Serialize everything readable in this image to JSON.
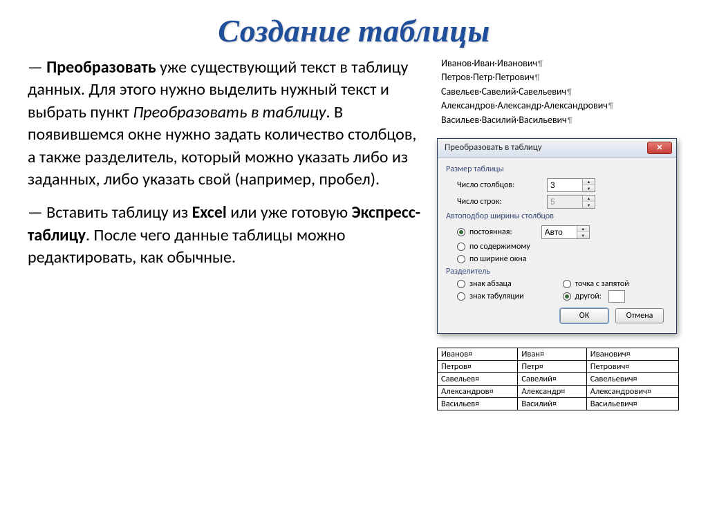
{
  "title": "Создание таблицы",
  "body": {
    "para1_pre": "— ",
    "para1_b1": "Преобразовать",
    "para1_mid1": " уже существующий текст в таблицу данных. Для этого нужно выделить нужный текст и выбрать пункт ",
    "para1_i1": "Преобразовать в таблицу",
    "para1_mid2": ". В появившемся окне нужно задать количество столбцов, а также разделитель, который  можно указать либо из заданных, либо указать свой (например, пробел).",
    "para2_pre": "— Вставить таблицу из ",
    "para2_b1": "Excel",
    "para2_mid1": " или уже готовую ",
    "para2_b2": "Экспресс-таблицу",
    "para2_mid2": ". После чего данные таблицы можно редактировать, как обычные."
  },
  "names": [
    "Иванов·Иван·Иванович",
    "Петров·Петр·Петрович",
    "Савельев·Савелий·Савельевич",
    "Александров·Александр·Александрович",
    "Васильев·Василий·Васильевич"
  ],
  "dialog": {
    "title": "Преобразовать в таблицу",
    "close_glyph": "✕",
    "size_group": "Размер таблицы",
    "cols_label": "Число столбцов:",
    "cols_value": "3",
    "rows_label": "Число строк:",
    "rows_value": "5",
    "autofit_group": "Автоподбор ширины столбцов",
    "autofit_fixed": "постоянная:",
    "autofit_value": "Авто",
    "autofit_content": "по содержимому",
    "autofit_window": "по ширине окна",
    "sep_group": "Разделитель",
    "sep_para": "знак абзаца",
    "sep_semicolon": "точка с запятой",
    "sep_tab": "знак табуляции",
    "sep_other": "другой:",
    "btn_ok": "ОК",
    "btn_cancel": "Отмена"
  },
  "result_table": [
    [
      "Иванов¤",
      "Иван¤",
      "Иванович¤"
    ],
    [
      "Петров¤",
      "Петр¤",
      "Петрович¤"
    ],
    [
      "Савельев¤",
      "Савелий¤",
      "Савельевич¤"
    ],
    [
      "Александров¤",
      "Александр¤",
      "Александрович¤"
    ],
    [
      "Васильев¤",
      "Василий¤",
      "Васильевич¤"
    ]
  ]
}
